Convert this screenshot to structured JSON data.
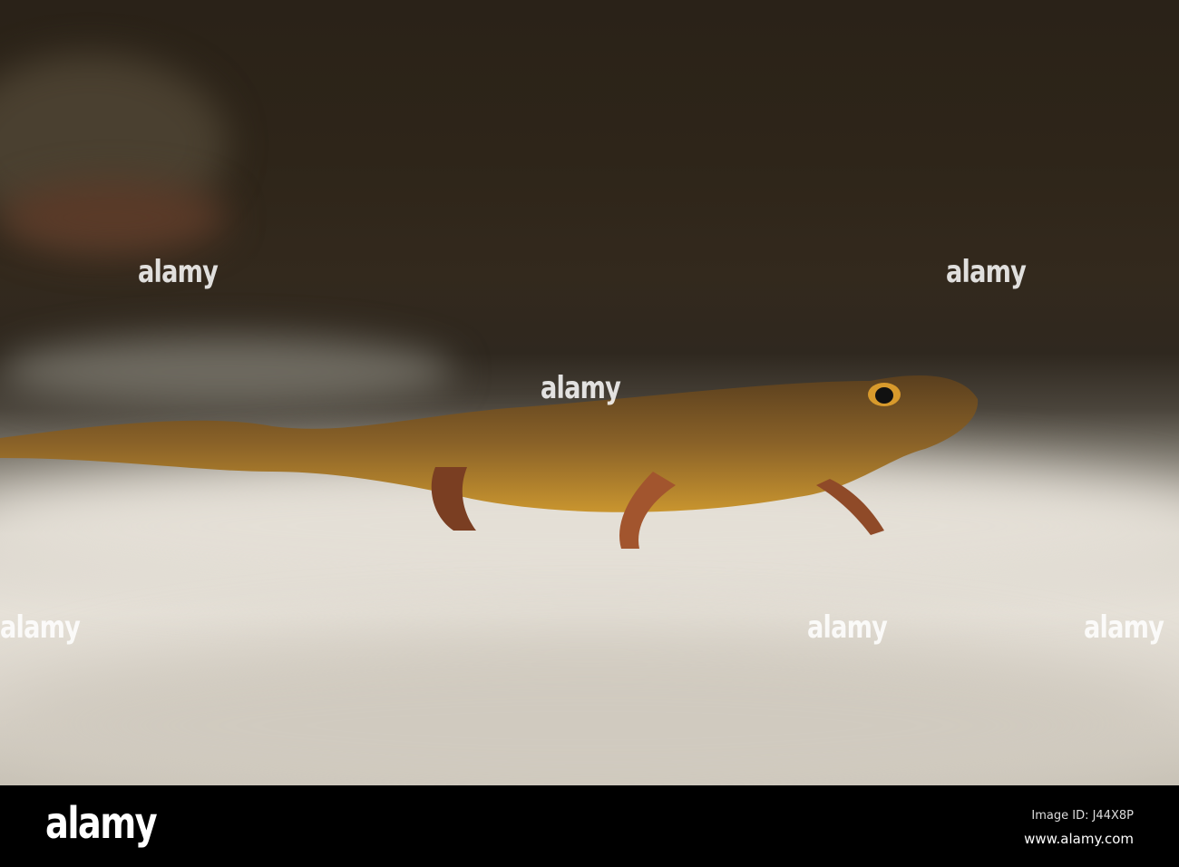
{
  "watermark": {
    "text": "alamy"
  },
  "footer": {
    "logo": "alamy",
    "image_id": "Image ID: J44X8P",
    "site": "www.alamy.com"
  }
}
